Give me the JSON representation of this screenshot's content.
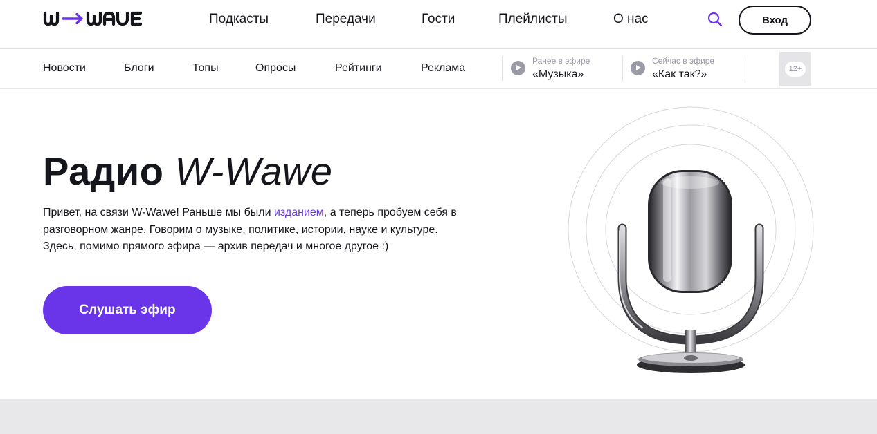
{
  "brand": {
    "logo_text": "W-WAVE",
    "accent_color": "#6a35e8",
    "text_color": "#15151c",
    "muted_color": "#9a9aa6"
  },
  "header": {
    "nav": [
      "Подкасты",
      "Передачи",
      "Гости",
      "Плейлисты",
      "О нас"
    ],
    "search_icon": "search-icon",
    "login_label": "Вход"
  },
  "subnav": {
    "items": [
      "Новости",
      "Блоги",
      "Топы",
      "Опросы",
      "Рейтинги",
      "Реклама"
    ],
    "previous": {
      "caption": "Ранее в эфире",
      "title": "«Музыка»",
      "icon": "play-icon"
    },
    "current": {
      "caption": "Сейчас в эфире",
      "title": "«Как так?»",
      "icon": "play-icon"
    },
    "age_rating": "12+"
  },
  "hero": {
    "title_bold": "Радио",
    "title_italic": "W-Wawe",
    "text_before_link": "Привет, на связи W-Wawe! Раньше мы были ",
    "link_text": "изданием",
    "text_after_link": ", а теперь пробуем себя в разговорном жанре. Говорим о музыке, политике, истории, науке и культуре. Здесь, помимо прямого эфира — архив передач и многое другое :)",
    "cta_label": "Слушать эфир",
    "illustration_icon": "microphone-icon"
  }
}
